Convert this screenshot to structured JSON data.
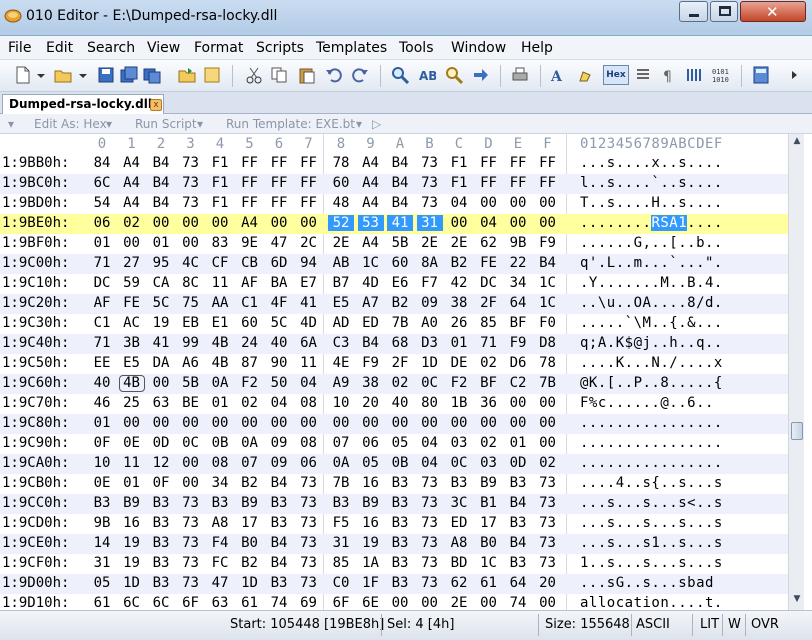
{
  "window": {
    "title": "010 Editor - E:\\Dumped-rsa-locky.dll",
    "close_glyph": "✕"
  },
  "menu": [
    "File",
    "Edit",
    "Search",
    "View",
    "Format",
    "Scripts",
    "Templates",
    "Tools",
    "Window",
    "Help"
  ],
  "toolbar": {
    "hex_label": "Hex"
  },
  "tab": {
    "label": "Dumped-rsa-locky.dll",
    "close_glyph": "x"
  },
  "subbar": {
    "edit_as": "Edit As: Hex",
    "run_script": "Run Script",
    "run_template": "Run Template: EXE.bt"
  },
  "hex": {
    "column_labels": [
      "0",
      "1",
      "2",
      "3",
      "4",
      "5",
      "6",
      "7",
      "8",
      "9",
      "A",
      "B",
      "C",
      "D",
      "E",
      "F"
    ],
    "ascii_header": "0123456789ABCDEF",
    "rows": [
      {
        "addr": "1:9BB0h:",
        "bytes": [
          "84",
          "A4",
          "B4",
          "73",
          "F1",
          "FF",
          "FF",
          "FF",
          "78",
          "A4",
          "B4",
          "73",
          "F1",
          "FF",
          "FF",
          "FF"
        ],
        "ascii": "...s....x..s...."
      },
      {
        "addr": "1:9BC0h:",
        "bytes": [
          "6C",
          "A4",
          "B4",
          "73",
          "F1",
          "FF",
          "FF",
          "FF",
          "60",
          "A4",
          "B4",
          "73",
          "F1",
          "FF",
          "FF",
          "FF"
        ],
        "ascii": "l..s....`..s...."
      },
      {
        "addr": "1:9BD0h:",
        "bytes": [
          "54",
          "A4",
          "B4",
          "73",
          "F1",
          "FF",
          "FF",
          "FF",
          "48",
          "A4",
          "B4",
          "73",
          "04",
          "00",
          "00",
          "00"
        ],
        "ascii": "T..s....H..s...."
      },
      {
        "addr": "1:9BE0h:",
        "bytes": [
          "06",
          "02",
          "00",
          "00",
          "00",
          "A4",
          "00",
          "00",
          "52",
          "53",
          "41",
          "31",
          "00",
          "04",
          "00",
          "00"
        ],
        "ascii_pre": "........",
        "ascii_sel": "RSA1",
        "ascii_post": "....",
        "highlight": true
      },
      {
        "addr": "1:9BF0h:",
        "bytes": [
          "01",
          "00",
          "01",
          "00",
          "83",
          "9E",
          "47",
          "2C",
          "2E",
          "A4",
          "5B",
          "2E",
          "2E",
          "62",
          "9B",
          "F9"
        ],
        "ascii": "......G,..[..b.."
      },
      {
        "addr": "1:9C00h:",
        "bytes": [
          "71",
          "27",
          "95",
          "4C",
          "CF",
          "CB",
          "6D",
          "94",
          "AB",
          "1C",
          "60",
          "8A",
          "B2",
          "FE",
          "22",
          "B4"
        ],
        "ascii": "q'.L..m...`...\"."
      },
      {
        "addr": "1:9C10h:",
        "bytes": [
          "DC",
          "59",
          "CA",
          "8C",
          "11",
          "AF",
          "BA",
          "E7",
          "B7",
          "4D",
          "E6",
          "F7",
          "42",
          "DC",
          "34",
          "1C"
        ],
        "ascii": ".Y.......M..B.4."
      },
      {
        "addr": "1:9C20h:",
        "bytes": [
          "AF",
          "FE",
          "5C",
          "75",
          "AA",
          "C1",
          "4F",
          "41",
          "E5",
          "A7",
          "B2",
          "09",
          "38",
          "2F",
          "64",
          "1C"
        ],
        "ascii": "..\\u..OA....8/d."
      },
      {
        "addr": "1:9C30h:",
        "bytes": [
          "C1",
          "AC",
          "19",
          "EB",
          "E1",
          "60",
          "5C",
          "4D",
          "AD",
          "ED",
          "7B",
          "A0",
          "26",
          "85",
          "BF",
          "F0"
        ],
        "ascii": ".....`\\M..{.&..."
      },
      {
        "addr": "1:9C40h:",
        "bytes": [
          "71",
          "3B",
          "41",
          "99",
          "4B",
          "24",
          "40",
          "6A",
          "C3",
          "B4",
          "68",
          "D3",
          "01",
          "71",
          "F9",
          "D8"
        ],
        "ascii": "q;A.K$@j..h..q.."
      },
      {
        "addr": "1:9C50h:",
        "bytes": [
          "EE",
          "E5",
          "DA",
          "A6",
          "4B",
          "87",
          "90",
          "11",
          "4E",
          "F9",
          "2F",
          "1D",
          "DE",
          "02",
          "D6",
          "78"
        ],
        "ascii": "....K...N./....x"
      },
      {
        "addr": "1:9C60h:",
        "bytes": [
          "40",
          "4B",
          "00",
          "5B",
          "0A",
          "F2",
          "50",
          "04",
          "A9",
          "38",
          "02",
          "0C",
          "F2",
          "BF",
          "C2",
          "7B"
        ],
        "ascii": "@K.[..P..8.....{",
        "boxed_index": 1
      },
      {
        "addr": "1:9C70h:",
        "bytes": [
          "46",
          "25",
          "63",
          "BE",
          "01",
          "02",
          "04",
          "08",
          "10",
          "20",
          "40",
          "80",
          "1B",
          "36",
          "00",
          "00"
        ],
        "ascii": "F%c......@..6.."
      },
      {
        "addr": "1:9C80h:",
        "bytes": [
          "01",
          "00",
          "00",
          "00",
          "00",
          "00",
          "00",
          "00",
          "00",
          "00",
          "00",
          "00",
          "00",
          "00",
          "00",
          "00"
        ],
        "ascii": "................"
      },
      {
        "addr": "1:9C90h:",
        "bytes": [
          "0F",
          "0E",
          "0D",
          "0C",
          "0B",
          "0A",
          "09",
          "08",
          "07",
          "06",
          "05",
          "04",
          "03",
          "02",
          "01",
          "00"
        ],
        "ascii": "................"
      },
      {
        "addr": "1:9CA0h:",
        "bytes": [
          "10",
          "11",
          "12",
          "00",
          "08",
          "07",
          "09",
          "06",
          "0A",
          "05",
          "0B",
          "04",
          "0C",
          "03",
          "0D",
          "02"
        ],
        "ascii": "................"
      },
      {
        "addr": "1:9CB0h:",
        "bytes": [
          "0E",
          "01",
          "0F",
          "00",
          "34",
          "B2",
          "B4",
          "73",
          "7B",
          "16",
          "B3",
          "73",
          "B3",
          "B9",
          "B3",
          "73"
        ],
        "ascii": "....4..s{..s...s"
      },
      {
        "addr": "1:9CC0h:",
        "bytes": [
          "B3",
          "B9",
          "B3",
          "73",
          "B3",
          "B9",
          "B3",
          "73",
          "B3",
          "B9",
          "B3",
          "73",
          "3C",
          "B1",
          "B4",
          "73"
        ],
        "ascii": "...s...s...s<..s"
      },
      {
        "addr": "1:9CD0h:",
        "bytes": [
          "9B",
          "16",
          "B3",
          "73",
          "A8",
          "17",
          "B3",
          "73",
          "F5",
          "16",
          "B3",
          "73",
          "ED",
          "17",
          "B3",
          "73"
        ],
        "ascii": "...s...s...s...s"
      },
      {
        "addr": "1:9CE0h:",
        "bytes": [
          "14",
          "19",
          "B3",
          "73",
          "F4",
          "B0",
          "B4",
          "73",
          "31",
          "19",
          "B3",
          "73",
          "A8",
          "B0",
          "B4",
          "73"
        ],
        "ascii": "...s...s1..s...s"
      },
      {
        "addr": "1:9CF0h:",
        "bytes": [
          "31",
          "19",
          "B3",
          "73",
          "FC",
          "B2",
          "B4",
          "73",
          "85",
          "1A",
          "B3",
          "73",
          "BD",
          "1C",
          "B3",
          "73"
        ],
        "ascii": "1..s...s...s...s"
      },
      {
        "addr": "1:9D00h:",
        "bytes": [
          "05",
          "1D",
          "B3",
          "73",
          "47",
          "1D",
          "B3",
          "73",
          "C0",
          "1F",
          "B3",
          "73",
          "62",
          "61",
          "64",
          "20"
        ],
        "ascii": "...sG..s...sbad "
      },
      {
        "addr": "1:9D10h:",
        "bytes": [
          "61",
          "6C",
          "6C",
          "6F",
          "63",
          "61",
          "74",
          "69",
          "6F",
          "6E",
          "00",
          "00",
          "2E",
          "00",
          "74",
          "00"
        ],
        "ascii": "allocation....t."
      }
    ]
  },
  "status": {
    "start": "Start: 105448 [19BE8h]",
    "sel": "Sel: 4 [4h]",
    "size": "Size: 155648",
    "encoding": "ASCII",
    "endian": "LIT",
    "mode": "W",
    "insert": "OVR"
  }
}
